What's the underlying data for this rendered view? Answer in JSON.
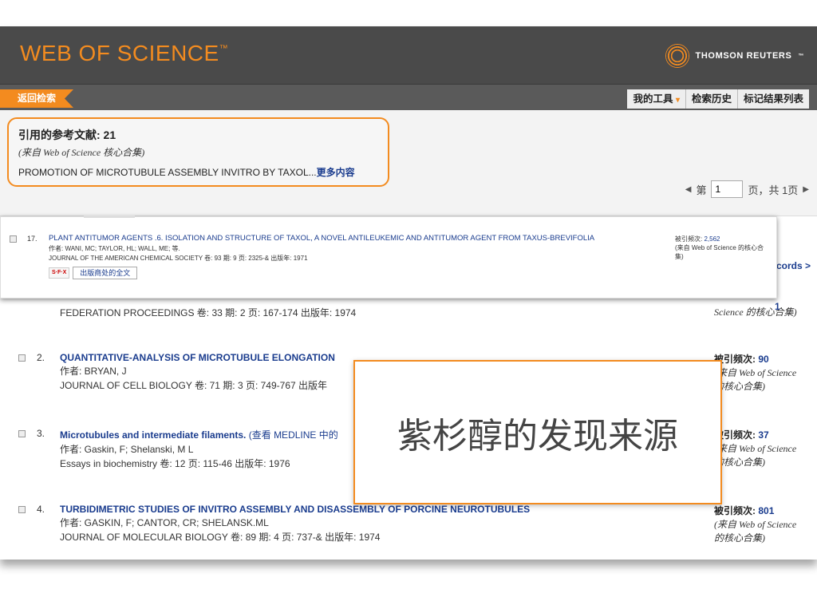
{
  "header": {
    "logo": "WEB OF SCIENCE",
    "logo_tm": "™",
    "brand": "THOMSON REUTERS",
    "brand_tm": "™"
  },
  "nav": {
    "back": "返回检索",
    "my_tools": "我的工具",
    "caret": "▾",
    "history": "检索历史",
    "marked": "标记结果列表"
  },
  "refbox": {
    "title": "引用的参考文献: 21",
    "source": "(来自 Web of Science 核心合集)",
    "article": "PROMOTION OF MICROTUBULE ASSEMBLY INVITRO BY TAXOL...",
    "more": "更多内容"
  },
  "pager": {
    "prev": "◀",
    "label_before": "第",
    "value": "1",
    "label_after": "页，共 1页",
    "next": "▶"
  },
  "popup": {
    "num": "17.",
    "title": "PLANT ANTITUMOR AGENTS .6. ISOLATION AND STRUCTURE OF TAXOL, A NOVEL ANTILEUKEMIC AND ANTITUMOR AGENT FROM TAXUS-BREVIFOLIA",
    "authors": "作者: WANI, MC; TAYLOR, HL; WALL, ME; 等.",
    "journal": "JOURNAL OF THE AMERICAN CHEMICAL SOCIETY 卷: 93  期: 9  页: 2325-&  出版年: 1971",
    "sfx": "S·F·X",
    "fulltext": "出版商处的全文",
    "cite_label": "被引频次:",
    "cite_value": "2,562",
    "cite_src": "(来自 Web of Science 的核心合集)"
  },
  "behind": {
    "records": "cords >",
    "one": "1"
  },
  "records": [
    {
      "num": "",
      "title": "",
      "authors": "",
      "journal": "FEDERATION PROCEEDINGS 卷: 33  期: 2  页: 167-174  出版年: 1974",
      "cite_label": "",
      "cite_value": "",
      "cite_src": "Science 的核心合集)"
    },
    {
      "num": "2.",
      "title": "QUANTITATIVE-ANALYSIS OF MICROTUBULE ELONGATION",
      "authors": "作者: BRYAN, J",
      "journal": "JOURNAL OF CELL BIOLOGY 卷: 71  期: 3  页: 749-767  出版年",
      "cite_label": "被引频次:",
      "cite_value": "90",
      "cite_src": "(来自 Web of Science 的核心合集)"
    },
    {
      "num": "3.",
      "title": "Microtubules and intermediate filaments.",
      "medline": "(查看 MEDLINE 中的",
      "authors": "作者: Gaskin, F; Shelanski, M L",
      "journal": "Essays in biochemistry 卷: 12  页: 115-46  出版年: 1976",
      "cite_label": "被引频次:",
      "cite_value": "37",
      "cite_src": "(来自 Web of Science 的核心合集)"
    },
    {
      "num": "4.",
      "title": "TURBIDIMETRIC STUDIES OF INVITRO ASSEMBLY AND DISASSEMBLY OF PORCINE NEUROTUBULES",
      "authors": "作者: GASKIN, F; CANTOR, CR; SHELANSK.ML",
      "journal": "JOURNAL OF MOLECULAR BIOLOGY 卷: 89  期: 4  页: 737-&  出版年: 1974",
      "cite_label": "被引频次:",
      "cite_value": "801",
      "cite_src": "(来自 Web of Science 的核心合集)"
    }
  ],
  "overlay": {
    "text": "紫杉醇的发现来源"
  }
}
